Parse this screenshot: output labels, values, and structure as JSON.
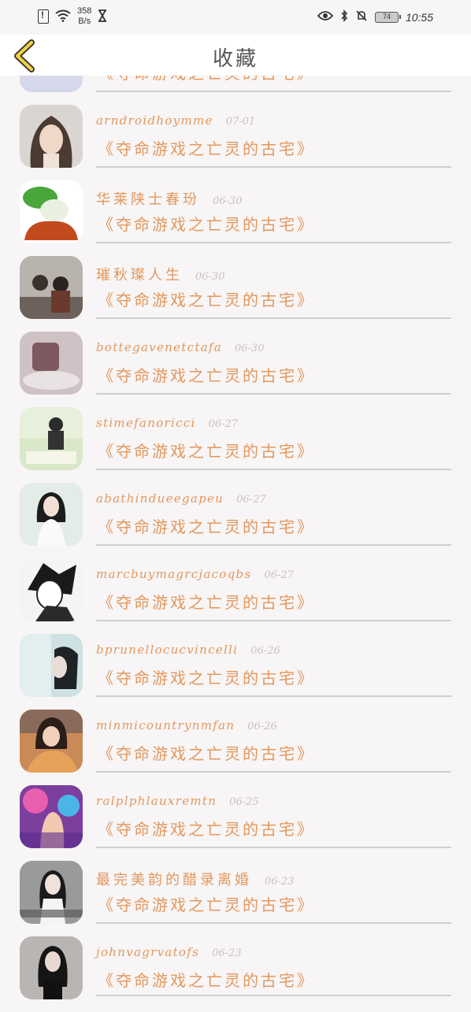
{
  "status_bar": {
    "net_speed_value": "358",
    "net_speed_unit": "B/s",
    "battery": "74",
    "time": "10:55"
  },
  "header": {
    "title": "收藏"
  },
  "partial_row": {
    "title": "《夺命游戏之亡灵的古宅》"
  },
  "items": [
    {
      "user": "arndroidhoymme",
      "date": "07-01",
      "title": "《夺命游戏之亡灵的古宅》"
    },
    {
      "user": "华莱陕士春玢",
      "date": "06-30",
      "title": "《夺命游戏之亡灵的古宅》"
    },
    {
      "user": "璀秋璨人生",
      "date": "06-30",
      "title": "《夺命游戏之亡灵的古宅》"
    },
    {
      "user": "bottegavenetctafa",
      "date": "06-30",
      "title": "《夺命游戏之亡灵的古宅》"
    },
    {
      "user": "stimefanoricci",
      "date": "06-27",
      "title": "《夺命游戏之亡灵的古宅》"
    },
    {
      "user": "abathindueegapeu",
      "date": "06-27",
      "title": "《夺命游戏之亡灵的古宅》"
    },
    {
      "user": "marcbuymagrcjacoqbs",
      "date": "06-27",
      "title": "《夺命游戏之亡灵的古宅》"
    },
    {
      "user": "bprunellocucvincelli",
      "date": "06-26",
      "title": "《夺命游戏之亡灵的古宅》"
    },
    {
      "user": "minmicountrynmfan",
      "date": "06-26",
      "title": "《夺命游戏之亡灵的古宅》"
    },
    {
      "user": "ralplphlauxremtn",
      "date": "06-25",
      "title": "《夺命游戏之亡灵的古宅》"
    },
    {
      "user": "最完美韵的醋录离婚",
      "date": "06-23",
      "title": "《夺命游戏之亡灵的古宅》"
    },
    {
      "user": "johnvagrvatofs",
      "date": "06-23",
      "title": "《夺命游戏之亡灵的古宅》"
    }
  ],
  "colors": {
    "accent": "#e2985e",
    "date": "#c6c1bd",
    "divider": "#cfcfcf",
    "background": "#f7f5f5"
  }
}
